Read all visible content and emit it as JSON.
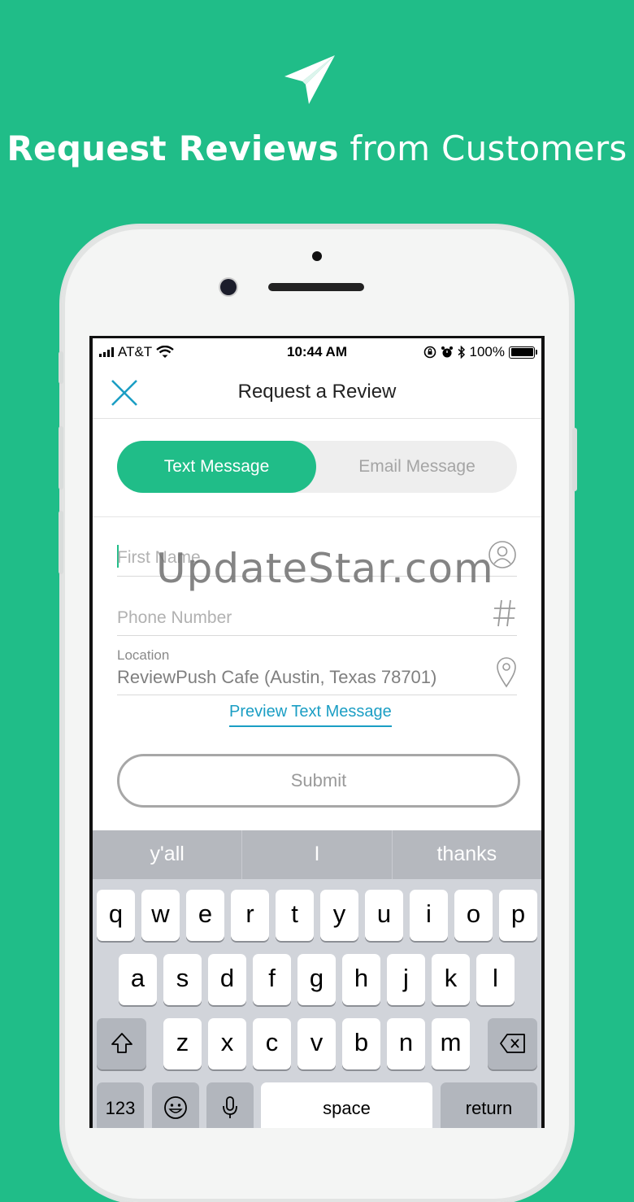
{
  "promo": {
    "title_bold": "Request Reviews",
    "title_light": " from Customers",
    "icon": "paper-plane-icon"
  },
  "statusbar": {
    "carrier": "AT&T",
    "time": "10:44 AM",
    "battery": "100%"
  },
  "navbar": {
    "title": "Request a Review",
    "close_icon": "close-icon"
  },
  "segment": {
    "text_label": "Text Message",
    "email_label": "Email Message",
    "active": "Text Message"
  },
  "form": {
    "first_name_placeholder": "First Name",
    "phone_placeholder": "Phone Number",
    "location_label": "Location",
    "location_value": "ReviewPush Cafe (Austin, Texas 78701)",
    "preview_link": "Preview Text Message",
    "submit_label": "Submit"
  },
  "watermark": "UpdateStar.com",
  "keyboard": {
    "predictions": [
      "y'all",
      "I",
      "thanks"
    ],
    "row1": [
      "q",
      "w",
      "e",
      "r",
      "t",
      "y",
      "u",
      "i",
      "o",
      "p"
    ],
    "row2": [
      "a",
      "s",
      "d",
      "f",
      "g",
      "h",
      "j",
      "k",
      "l"
    ],
    "row3": [
      "z",
      "x",
      "c",
      "v",
      "b",
      "n",
      "m"
    ],
    "numbers_label": "123",
    "space_label": "space",
    "return_label": "return"
  },
  "colors": {
    "brand_green": "#20bd88",
    "link_blue": "#1b9ec4"
  }
}
